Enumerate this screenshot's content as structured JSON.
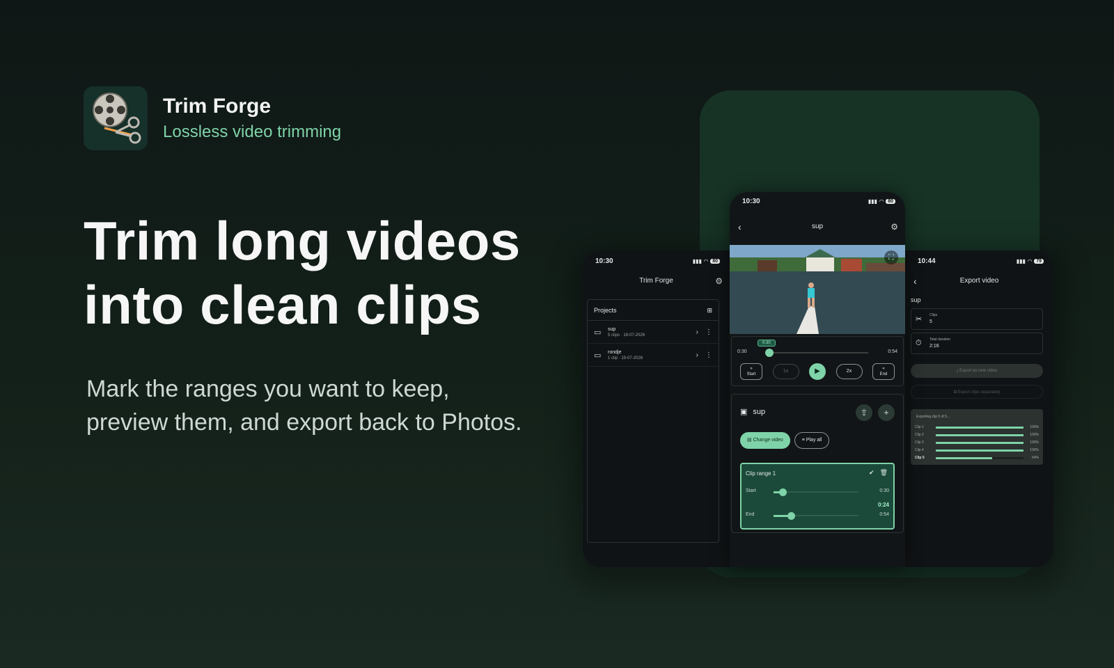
{
  "brand": {
    "app_name": "Trim Forge",
    "tagline": "Lossless video trimming"
  },
  "hero": {
    "headline_line1": "Trim long videos",
    "headline_line2": "into clean clips",
    "subtext_line1": "Mark the ranges you want to keep,",
    "subtext_line2": "preview them, and export back to Photos."
  },
  "colors": {
    "accent": "#7fd3a8",
    "background": "#132019",
    "card": "#173326"
  },
  "phone_left": {
    "time": "10:30",
    "battery": "80",
    "title": "Trim Forge",
    "projects_label": "Projects",
    "projects": [
      {
        "name": "sup",
        "meta": "5 clips · 19-07-2026"
      },
      {
        "name": "rondje",
        "meta": "1 clip · 19-07-2026"
      }
    ]
  },
  "phone_center": {
    "time": "10:30",
    "battery": "80",
    "title": "sup",
    "scrub": {
      "bubble": "0:30",
      "start": "0:30",
      "end": "0:54",
      "position": 0.0
    },
    "controls": {
      "start": "Start",
      "speed1": "1x",
      "speed2": "2x",
      "end": "End"
    },
    "project_name": "sup",
    "change_video": "Change video",
    "play_all": "Play all",
    "clip_range": {
      "title": "Clip range 1",
      "start_label": "Start",
      "start_value": "0:30",
      "duration": "0:24",
      "end_label": "End",
      "end_value": "0:54"
    }
  },
  "phone_right": {
    "time": "10:44",
    "battery": "79",
    "title": "Export video",
    "project": "sup",
    "clips_label": "Clips",
    "clips_value": "5",
    "duration_label": "Total duration",
    "duration_value": "2:16",
    "export_new": "Export as new video",
    "export_separate": "Export clips separately",
    "progress_title": "Exporting clip 5 of 5...",
    "progress": [
      {
        "label": "Clip 1",
        "pct": "100%",
        "value": 1.0
      },
      {
        "label": "Clip 2",
        "pct": "100%",
        "value": 1.0
      },
      {
        "label": "Clip 3",
        "pct": "100%",
        "value": 1.0
      },
      {
        "label": "Clip 4",
        "pct": "100%",
        "value": 1.0
      },
      {
        "label": "Clip 5",
        "pct": "64%",
        "value": 0.64
      }
    ]
  }
}
